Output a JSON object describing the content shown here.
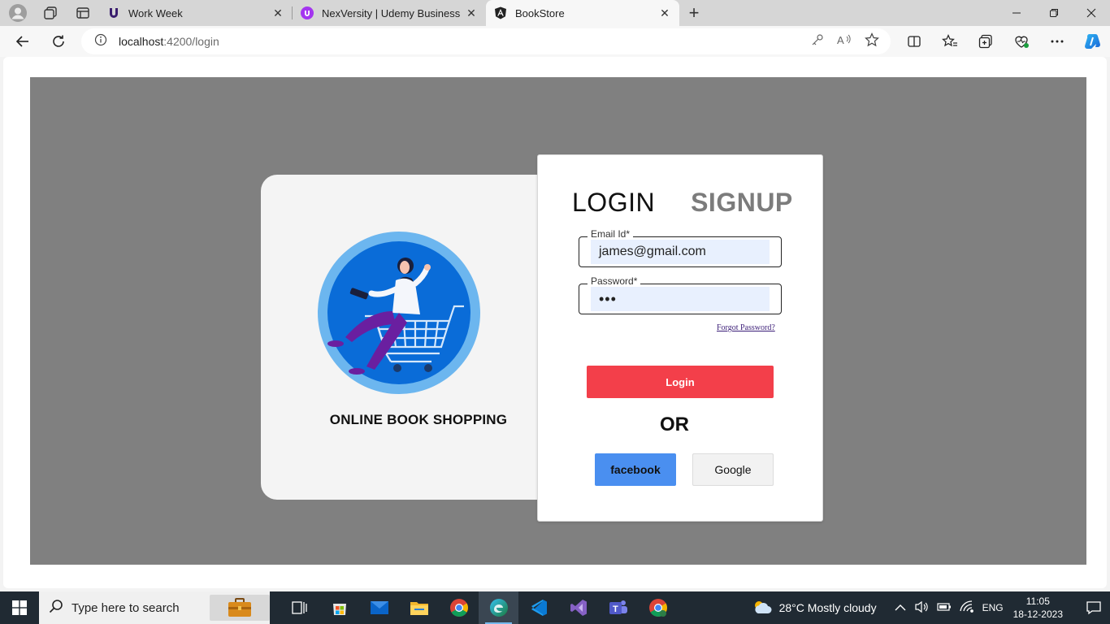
{
  "browser": {
    "tabs": [
      {
        "title": "Work Week",
        "icon": "u-logo-icon"
      },
      {
        "title": "NexVersity | Udemy Business",
        "icon": "udemy-icon"
      },
      {
        "title": "BookStore",
        "icon": "angular-icon",
        "active": true
      }
    ],
    "address": {
      "host": "localhost",
      "path": ":4200/login"
    }
  },
  "page": {
    "tagline": "ONLINE BOOK SHOPPING",
    "tab_login": "LOGIN",
    "tab_signup": "SIGNUP",
    "email_label": "Email Id*",
    "email_value": "james@gmail.com",
    "password_label": "Password*",
    "password_value": "•••",
    "forgot": "Forgot Password?",
    "login_button": "Login",
    "or": "OR",
    "facebook_button": "facebook",
    "google_button": "Google"
  },
  "taskbar": {
    "search_placeholder": "Type here to search",
    "weather": "28°C  Mostly cloudy",
    "language": "ENG",
    "time": "11:05",
    "date": "18-12-2023"
  },
  "colors": {
    "login_button": "#f33f4a",
    "facebook_button": "#4a8ff0",
    "stage": "#808080",
    "autofill": "#e8f0fe"
  }
}
